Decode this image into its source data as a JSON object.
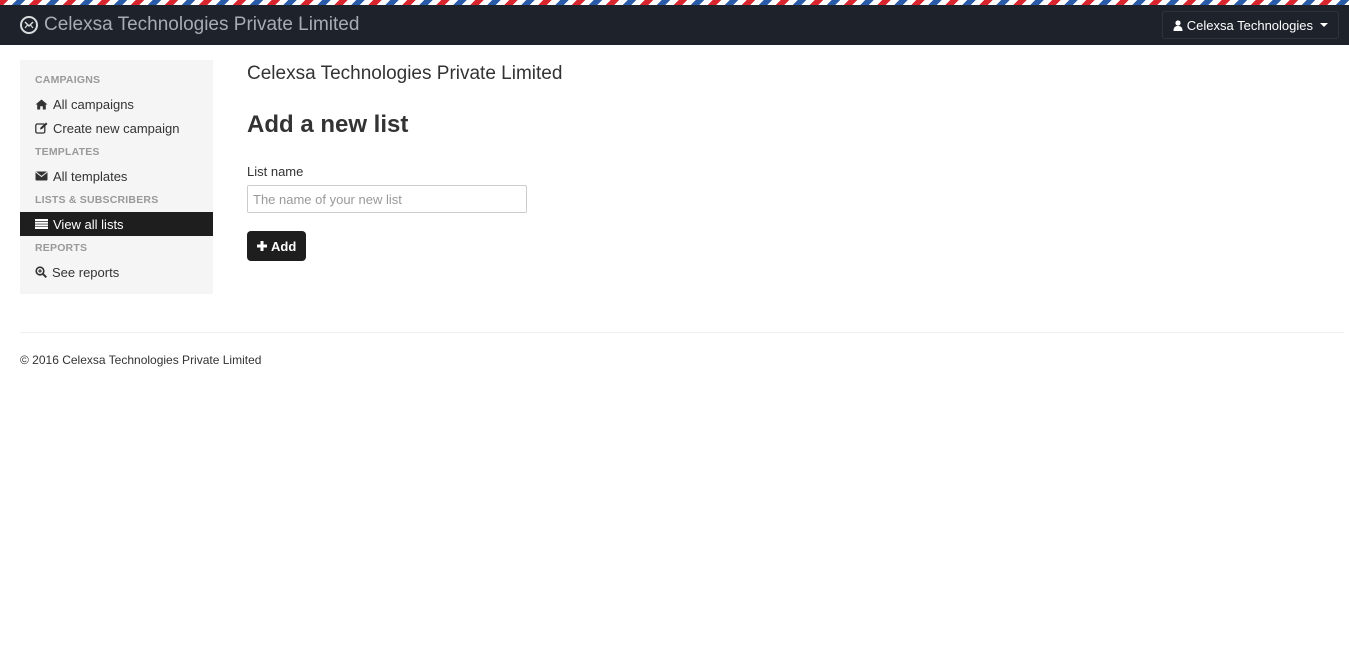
{
  "navbar": {
    "brand": "Celexsa Technologies Private Limited",
    "user_menu": "Celexsa Technologies"
  },
  "sidebar": {
    "sections": [
      {
        "header": "CAMPAIGNS",
        "items": [
          {
            "label": "All campaigns",
            "icon": "home-icon"
          },
          {
            "label": "Create new campaign",
            "icon": "edit-icon"
          }
        ]
      },
      {
        "header": "TEMPLATES",
        "items": [
          {
            "label": "All templates",
            "icon": "envelope-icon"
          }
        ]
      },
      {
        "header": "LISTS & SUBSCRIBERS",
        "items": [
          {
            "label": "View all lists",
            "icon": "list-icon",
            "active": true
          }
        ]
      },
      {
        "header": "REPORTS",
        "items": [
          {
            "label": "See reports",
            "icon": "zoom-icon"
          }
        ]
      }
    ]
  },
  "main": {
    "company": "Celexsa Technologies Private Limited",
    "title": "Add a new list",
    "list_name_label": "List name",
    "list_name_placeholder": "The name of your new list",
    "list_name_value": "",
    "add_button": "Add"
  },
  "footer": {
    "text": "© 2016 Celexsa Technologies Private Limited"
  },
  "colors": {
    "navbar_bg": "#1e232b",
    "active_item_bg": "#1e1e1e",
    "sidebar_bg": "#f5f5f5",
    "stripe_red": "#d9262e",
    "stripe_blue": "#2a5ba8"
  }
}
